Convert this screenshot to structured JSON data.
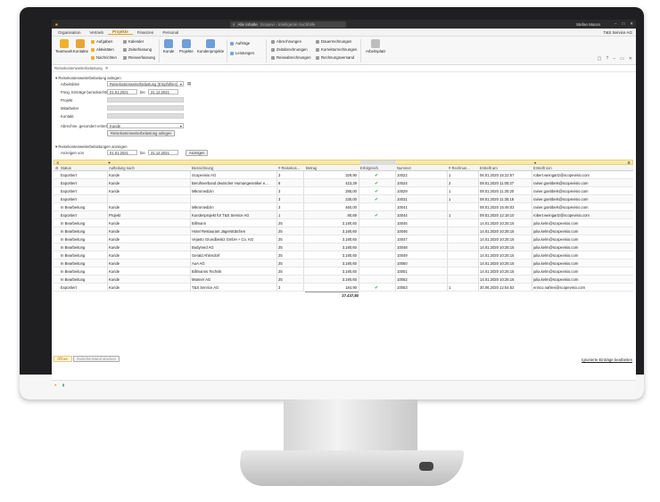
{
  "titlebar": {
    "search_text": "Alle Inhalte",
    "app_title": "Scopevi - Intelligente Suchhilfe",
    "user": "Stefan Maron"
  },
  "menu": {
    "tabs": [
      "Organisation",
      "Vertrieb",
      "Projekte",
      "Finanzen",
      "Personal"
    ],
    "active_tab": "Projekte",
    "company": "T&S Service AG"
  },
  "ribbon": {
    "teamwork": "Teamwork",
    "kontakte": "Kontakte",
    "aufgaben": "Aufgaben",
    "aktivitaeten": "Aktivitäten",
    "nachrichten": "Nachrichten",
    "kalender": "Kalender",
    "zeiterfassung": "Zeiterfassung",
    "reiseerfassung": "Reiseerfassung",
    "kunde": "Kunde",
    "projekte": "Projekte",
    "kundenprojekte": "Kundenprojekte",
    "auftraege": "Aufträge",
    "leistungen": "Leistungen",
    "abrechnungen": "Abrechnungen",
    "zeitabrechnungen": "Zeitabrechnungen",
    "reiseabrechnungen": "Reiseabrechnungen",
    "dauerrechnungen": "Dauerrechnungen",
    "korrekturrechnungen": "Korrekturrechnungen",
    "rechnungsversand": "Rechnungsversand",
    "arbeitsplatz": "Arbeitsplatz"
  },
  "doc_tab": "Reisekostenweiterbelastung",
  "form": {
    "section1": "Reisekostenweiterbelastung anlegen",
    "arbeitsliste_label": "Arbeitsliste",
    "arbeitsliste_value": "Reisekostenweiterbelastung (Empfohlen)",
    "zeitraum_label": "Freig. Einträge berücksichtige...",
    "date_from": "01.01.2021",
    "bis": "bis",
    "date_to": "31.12.2021",
    "projekt_label": "Projekt",
    "mitarbeiter_label": "Mitarbeiter",
    "kontakt_label": "Kontakt",
    "abrechne_label": "Abrechne. gesondert erstellen...",
    "abrechne_value": "Kunde",
    "create_button": "Reisekostenweiterbelastung anlegen",
    "section2": "Reisekostenweiterbelastungen anzeigen",
    "anzeigen_label": "Anzeigen von",
    "show_from": "01.01.2021",
    "show_to": "31.12.2021",
    "show_button": "Anzeigen"
  },
  "grid": {
    "columns": [
      "Status",
      "Aufteilung nach",
      "Bezeichnung",
      "# Reisekos...",
      "Betrag",
      "Erfolgreich",
      "Nummer",
      "# Rechnun...",
      "Erstellt am",
      "Erstellt von"
    ],
    "rows": [
      {
        "status": "Exportiert",
        "aufteilung": "Kunde",
        "bezeichnung": "Scopevisio AG",
        "reisekosten": "3",
        "betrag": "329,90",
        "erfolgreich": true,
        "nummer": "10022",
        "rechnungen": "1",
        "erstellt_am": "06.01.2020 15:22:57",
        "erstellt_von": "robert.weingartz@scopevisio.com"
      },
      {
        "status": "Exportiert",
        "aufteilung": "Kunde",
        "bezeichnung": "Berufsverband deutscher Humangenetiker e...",
        "reisekosten": "8",
        "betrag": "423,29",
        "erfolgreich": true,
        "nummer": "10024",
        "rechnungen": "2",
        "erstellt_am": "08.01.2020 11:05:27",
        "erstellt_von": "rainer.goebbels@scopevisio.com"
      },
      {
        "status": "Exportiert",
        "aufteilung": "Kunde",
        "bezeichnung": "Mikromedizin",
        "reisekosten": "3",
        "betrag": "285,00",
        "erfolgreich": true,
        "nummer": "10029",
        "rechnungen": "1",
        "erstellt_am": "08.01.2020 11:30:20",
        "erstellt_von": "rainer.goebbels@scopevisio.com"
      },
      {
        "status": "Exportiert",
        "aufteilung": "",
        "bezeichnung": "",
        "reisekosten": "3",
        "betrag": "230,00",
        "erfolgreich": true,
        "nummer": "10031",
        "rechnungen": "1",
        "erstellt_am": "08.01.2020 11:35:18",
        "erstellt_von": "rainer.goebbels@scopevisio.com"
      },
      {
        "status": "In Bearbeitung",
        "aufteilung": "Kunde",
        "bezeichnung": "Mikromedizin",
        "reisekosten": "3",
        "betrag": "460,00",
        "erfolgreich": false,
        "nummer": "10041",
        "rechnungen": "",
        "erstellt_am": "08.01.2020 15:46:03",
        "erstellt_von": "rainer.goebbels@scopevisio.com"
      },
      {
        "status": "Exportiert",
        "aufteilung": "Projekt",
        "bezeichnung": "Kundenprojekt für T&S Service AG",
        "reisekosten": "1",
        "betrag": "80,69",
        "erfolgreich": true,
        "nummer": "10044",
        "rechnungen": "1",
        "erstellt_am": "09.01.2020 12:18:10",
        "erstellt_von": "robert.weingartz@scopevisio.com"
      },
      {
        "status": "In Bearbeitung",
        "aufteilung": "Kunde",
        "bezeichnung": "Billmann",
        "reisekosten": "25",
        "betrag": "3.180,60",
        "erfolgreich": false,
        "nummer": "10045",
        "rechnungen": "",
        "erstellt_am": "14.01.2020 10:25:15",
        "erstellt_von": "julia.kelm@scopevisio.com"
      },
      {
        "status": "In Bearbeitung",
        "aufteilung": "Kunde",
        "bezeichnung": "Hotel Restaurant Jägerstübchen",
        "reisekosten": "25",
        "betrag": "3.180,60",
        "erfolgreich": false,
        "nummer": "10046",
        "rechnungen": "",
        "erstellt_am": "14.01.2020 10:25:15",
        "erstellt_von": "julia.kelm@scopevisio.com"
      },
      {
        "status": "In Bearbeitung",
        "aufteilung": "Kunde",
        "bezeichnung": "Vejasto Grundbesitz GmbH + Co. KG",
        "reisekosten": "25",
        "betrag": "3.180,60",
        "erfolgreich": false,
        "nummer": "10047",
        "rechnungen": "",
        "erstellt_am": "14.01.2020 10:25:15",
        "erstellt_von": "julia.kelm@scopevisio.com"
      },
      {
        "status": "In Bearbeitung",
        "aufteilung": "Kunde",
        "bezeichnung": "Bodymed AG",
        "reisekosten": "25",
        "betrag": "3.180,60",
        "erfolgreich": false,
        "nummer": "10048",
        "rechnungen": "",
        "erstellt_am": "14.01.2020 10:25:15",
        "erstellt_von": "julia.kelm@scopevisio.com"
      },
      {
        "status": "In Bearbeitung",
        "aufteilung": "Kunde",
        "bezeichnung": "Gerald Ahlendorf",
        "reisekosten": "25",
        "betrag": "3.180,60",
        "erfolgreich": false,
        "nummer": "10049",
        "rechnungen": "",
        "erstellt_am": "14.01.2020 10:25:15",
        "erstellt_von": "julia.kelm@scopevisio.com"
      },
      {
        "status": "In Bearbeitung",
        "aufteilung": "Kunde",
        "bezeichnung": "AuA AG",
        "reisekosten": "25",
        "betrag": "3.180,60",
        "erfolgreich": false,
        "nummer": "10050",
        "rechnungen": "",
        "erstellt_am": "14.01.2020 10:25:15",
        "erstellt_von": "julia.kelm@scopevisio.com"
      },
      {
        "status": "In Bearbeitung",
        "aufteilung": "Kunde",
        "bezeichnung": "Billmanns Technik",
        "reisekosten": "25",
        "betrag": "3.180,60",
        "erfolgreich": false,
        "nummer": "10051",
        "rechnungen": "",
        "erstellt_am": "14.01.2020 10:25:15",
        "erstellt_von": "julia.kelm@scopevisio.com"
      },
      {
        "status": "In Bearbeitung",
        "aufteilung": "Kunde",
        "bezeichnung": "Manner AG",
        "reisekosten": "25",
        "betrag": "3.180,60",
        "erfolgreich": false,
        "nummer": "10052",
        "rechnungen": "",
        "erstellt_am": "14.01.2020 10:25:15",
        "erstellt_von": "julia.kelm@scopevisio.com"
      },
      {
        "status": "Exportiert",
        "aufteilung": "Kunde",
        "bezeichnung": "T&S Service AG",
        "reisekosten": "3",
        "betrag": "184,90",
        "erfolgreich": true,
        "nummer": "10053",
        "rechnungen": "1",
        "erstellt_am": "30.06.2020 12:54:52",
        "erstellt_von": "enrico.nahlen@scopevisio.com"
      }
    ],
    "total": "27.437,80"
  },
  "footer": {
    "btn_offnen": "Öffnen",
    "btn_zwischen": "Zwischenstand drucken",
    "link_edit": "Ignorierte Einträge bearbeiten"
  },
  "colors": {
    "accent": "#e0a020",
    "filter": "#fde9a7",
    "check": "#2e9e3e"
  }
}
